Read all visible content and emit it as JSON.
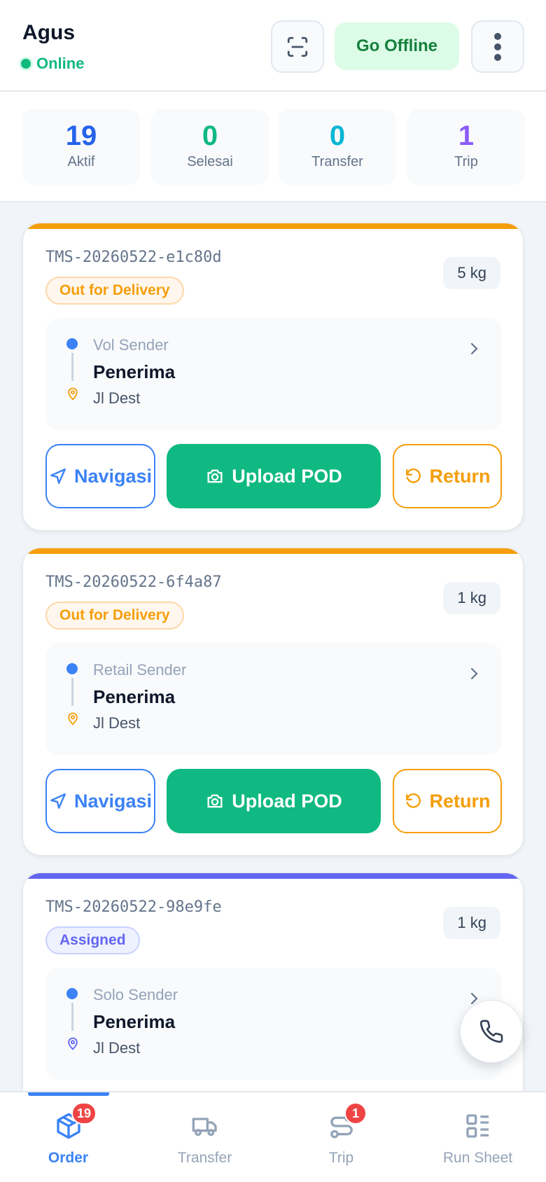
{
  "header": {
    "user_name": "Agus",
    "status": "Online",
    "offline_button": "Go Offline",
    "scan_icon": "scan-icon",
    "menu_icon": "more-vertical-icon"
  },
  "stats": [
    {
      "value": "19",
      "label": "Aktif",
      "color": "#2563eb"
    },
    {
      "value": "0",
      "label": "Selesai",
      "color": "#10b981"
    },
    {
      "value": "0",
      "label": "Transfer",
      "color": "#06b6d4"
    },
    {
      "value": "1",
      "label": "Trip",
      "color": "#8b5cf6"
    }
  ],
  "orders": [
    {
      "id": "TMS-20260522-e1c80d",
      "status": "Out for Delivery",
      "status_color": "#f59e0b",
      "weight": "5 kg",
      "sender": "Vol Sender",
      "receiver": "Penerima",
      "address": "Jl Dest",
      "buttons": {
        "navigate": "Navigasi",
        "upload": "Upload POD",
        "return": "Return"
      }
    },
    {
      "id": "TMS-20260522-6f4a87",
      "status": "Out for Delivery",
      "status_color": "#f59e0b",
      "weight": "1 kg",
      "sender": "Retail Sender",
      "receiver": "Penerima",
      "address": "Jl Dest",
      "buttons": {
        "navigate": "Navigasi",
        "upload": "Upload POD",
        "return": "Return"
      }
    },
    {
      "id": "TMS-20260522-98e9fe",
      "status": "Assigned",
      "status_color": "#6366f1",
      "weight": "1 kg",
      "sender": "Solo Sender",
      "receiver": "Penerima",
      "address": "Jl Dest"
    }
  ],
  "bottom_nav": [
    {
      "label": "Order",
      "icon": "package-icon",
      "badge": "19",
      "active": true
    },
    {
      "label": "Transfer",
      "icon": "truck-icon",
      "badge": null,
      "active": false
    },
    {
      "label": "Trip",
      "icon": "route-icon",
      "badge": "1",
      "active": false
    },
    {
      "label": "Run Sheet",
      "icon": "layout-list-icon",
      "badge": null,
      "active": false
    }
  ],
  "colors": {
    "primary": "#3b82f6",
    "success": "#10b981",
    "warning": "#f59e0b",
    "assigned": "#6366f1",
    "danger": "#ef4444"
  }
}
